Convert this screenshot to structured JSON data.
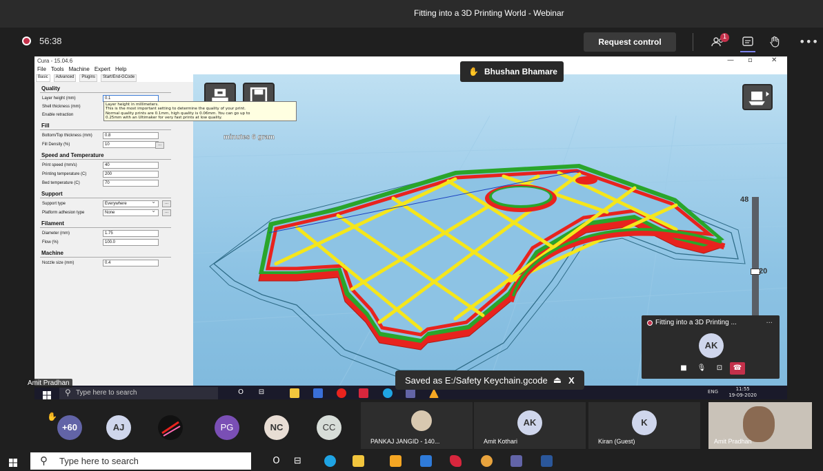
{
  "window": {
    "title": "Fitting into a 3D Printing World - Webinar"
  },
  "meeting": {
    "elapsed": "56:38",
    "request_control_label": "Request control",
    "participants_badge": "1",
    "presenter_name": "Bhushan Bhamare",
    "presenter_bottom_label": "Amit Pradhan"
  },
  "cura": {
    "title": "Cura - 15.04.6",
    "menu": [
      "File",
      "Tools",
      "Machine",
      "Expert",
      "Help"
    ],
    "tabs": [
      "Basic",
      "Advanced",
      "Plugins",
      "Start/End-GCode"
    ],
    "sections": {
      "quality": "Quality",
      "fill": "Fill",
      "speed": "Speed and Temperature",
      "support": "Support",
      "filament": "Filament",
      "machine": "Machine"
    },
    "fields": {
      "layer_height": {
        "label": "Layer height (mm)",
        "value": "0.1"
      },
      "shell_thickness": {
        "label": "Shell thickness (mm)"
      },
      "enable_retraction": {
        "label": "Enable retraction"
      },
      "bottom_top": {
        "label": "Bottom/Top thickness (mm)",
        "value": "0.8"
      },
      "fill_density": {
        "label": "Fill Density (%)",
        "value": "10"
      },
      "print_speed": {
        "label": "Print speed (mm/s)",
        "value": "40"
      },
      "print_temp": {
        "label": "Printing temperature (C)",
        "value": "200"
      },
      "bed_temp": {
        "label": "Bed temperature (C)",
        "value": "70"
      },
      "support_type": {
        "label": "Support type",
        "value": "Everywhere"
      },
      "adhesion": {
        "label": "Platform adhesion type",
        "value": "None"
      },
      "diameter": {
        "label": "Diameter (mm)",
        "value": "1.75"
      },
      "flow": {
        "label": "Flow (%)",
        "value": "100.0"
      },
      "nozzle": {
        "label": "Nozzle size (mm)",
        "value": "0.4"
      }
    },
    "dots_label": "...",
    "tooltip": [
      "Layer height in millimeters.",
      "This is the most important setting to determine the quality of your print.",
      "Normal quality prints are 0.1mm, high quality is 0.06mm. You can go up to",
      "0.25mm with an Ultimaker for very fast prints at low quality."
    ],
    "time_overlay": "minutes 6 gram",
    "layer_top": "48",
    "layer_current": "20"
  },
  "inner_taskbar": {
    "search_placeholder": "Type here to search",
    "tray": "ENG",
    "time": "11:55",
    "date": "19-09-2020"
  },
  "toast": {
    "text": "Saved as E:/Safety Keychain.gcode",
    "eject": "⏏",
    "close": "X"
  },
  "mini_window": {
    "title": "Fitting into a 3D Printing ...",
    "avatar": "AK",
    "more": "..."
  },
  "participants": {
    "count": "+60",
    "avatars": [
      "AJ",
      "PG",
      "NC",
      "CC"
    ],
    "tiles": [
      {
        "name": "PANKAJ JANGID - 140..."
      },
      {
        "name": "Amit Kothari",
        "avatar": "AK"
      },
      {
        "name": "Kiran (Guest)",
        "avatar": "K"
      },
      {
        "name": "Amit Pradhan"
      }
    ]
  },
  "taskbar": {
    "search_placeholder": "Type here to search"
  },
  "colors": {
    "accent": "#6264a7",
    "record": "#c4314b",
    "hangup": "#c4314b",
    "outer_red": "#e8231e",
    "green": "#2aa52a",
    "yellow": "#f5e61b"
  }
}
